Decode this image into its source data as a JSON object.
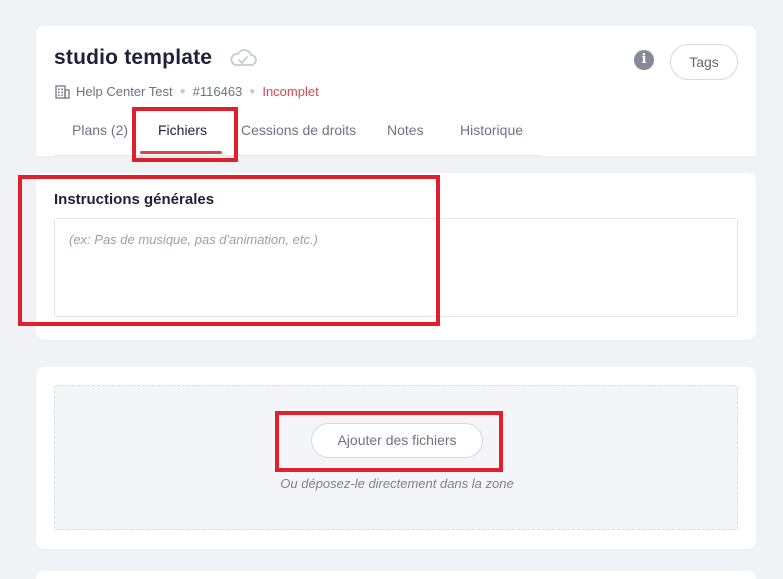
{
  "header": {
    "title": "studio template",
    "cloud_icon": "cloud-icon",
    "building_icon": "building-icon",
    "project_name": "Help Center Test",
    "ticket_number": "#116463",
    "status": "Incomplet",
    "status_color": "#e0424c",
    "info_icon": "i",
    "tags_label": "Tags"
  },
  "tabs": [
    {
      "label": "Plans (2)",
      "active": false
    },
    {
      "label": "Fichiers",
      "active": true
    },
    {
      "label": "Cessions de droits",
      "active": false
    },
    {
      "label": "Notes",
      "active": false
    },
    {
      "label": "Historique",
      "active": false
    }
  ],
  "instructions": {
    "title": "Instructions générales",
    "placeholder": "(ex: Pas de musique, pas d'animation, etc.)",
    "value": ""
  },
  "upload": {
    "button_label": "Ajouter des fichiers",
    "hint": "Ou déposez-le directement dans la zone"
  },
  "colors": {
    "accent": "#e0424c",
    "highlight": "#e0202a",
    "background": "#f1f2f6"
  }
}
